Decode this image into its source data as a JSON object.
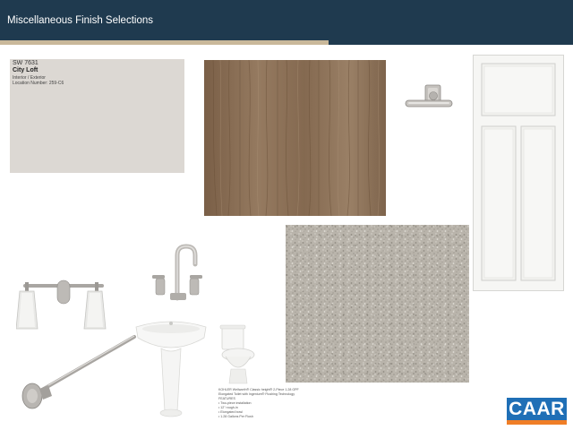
{
  "header": {
    "title": "Miscellaneous Finish Selections"
  },
  "paint_swatch": {
    "code": "SW 7631",
    "name": "City Loft",
    "use": "Interior / Exterior",
    "location": "Location Number: 259-C6",
    "color": "#dcd8d3"
  },
  "notes": {
    "lines": [
      "KOHLER Wellworth® Classic height® 2-Piece 1.28 GPF",
      "Elongated Toilet with Ingenium® Flushing Technology",
      "FEATURES",
      "• Two-piece installation",
      "• 12\" rough-in",
      "• Elongated bowl",
      "• 1.28 Gallons Per Flush"
    ]
  },
  "logo": {
    "text": "CAAR",
    "primary_color": "#1f6fb6",
    "secondary_color": "#f07e26"
  },
  "colors": {
    "header": "#1f3a4f",
    "accent": "#c9b89a",
    "wood": "#8a6f55",
    "carpet": "#b8b3aa"
  }
}
